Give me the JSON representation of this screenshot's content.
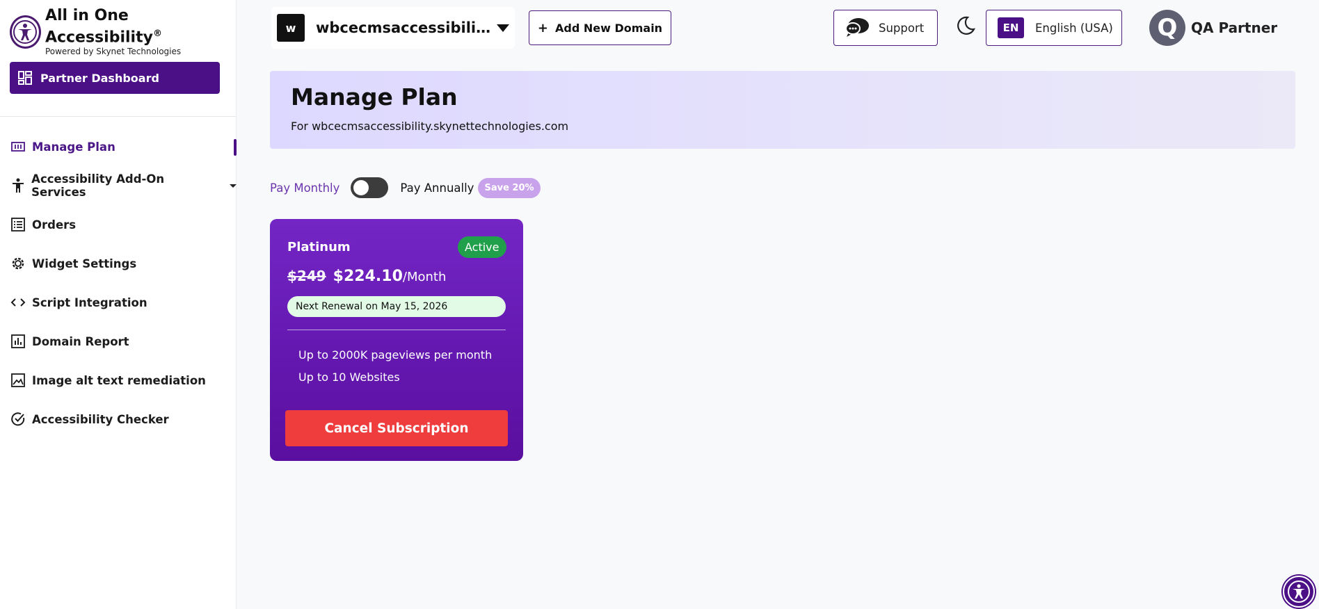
{
  "brand": {
    "title": "All in One Accessibility",
    "registered": "®",
    "subtitle": "Powered by Skynet Technologies"
  },
  "sidebar": {
    "dashboard_label": "Partner Dashboard",
    "items": [
      {
        "label": "Manage Plan",
        "icon": "plan-icon",
        "active": true
      },
      {
        "label": "Accessibility Add-On Services",
        "icon": "accessibility-person-icon",
        "has_dropdown": true
      },
      {
        "label": "Orders",
        "icon": "orders-list-icon"
      },
      {
        "label": "Widget Settings",
        "icon": "gear-icon"
      },
      {
        "label": "Script Integration",
        "icon": "code-icon"
      },
      {
        "label": "Domain Report",
        "icon": "bar-chart-icon"
      },
      {
        "label": "Image alt text remediation",
        "icon": "image-icon"
      },
      {
        "label": "Accessibility Checker",
        "icon": "check-circle-icon"
      }
    ]
  },
  "header": {
    "domain_badge": "w",
    "domain_name": "wbcecmsaccessibility.skynettechnologies.com",
    "add_domain_label": "Add New Domain",
    "support_label": "Support",
    "language_code": "EN",
    "language_label": "English (USA)",
    "user_initial": "Q",
    "user_name": "QA Partner"
  },
  "banner": {
    "title": "Manage Plan",
    "subtitle": "For wbcecmsaccessibility.skynettechnologies.com"
  },
  "billing": {
    "monthly_label": "Pay Monthly",
    "annually_label": "Pay Annually",
    "save_badge": "Save 20%",
    "annual_selected": false
  },
  "plan": {
    "name": "Platinum",
    "status": "Active",
    "old_price": "$249",
    "new_price": "$224.10",
    "period": "/Month",
    "renewal": "Next Renewal on May 15, 2026",
    "features": [
      "Up to 2000K pageviews per month",
      "Up to 10 Websites"
    ],
    "cancel_label": "Cancel Subscription"
  },
  "colors": {
    "brand_purple": "#4b0f86",
    "card_purple": "#6a1bb8",
    "active_green": "#20a04a",
    "cancel_red": "#ef3d3d",
    "banner_lavender": "#ddd8ff"
  }
}
